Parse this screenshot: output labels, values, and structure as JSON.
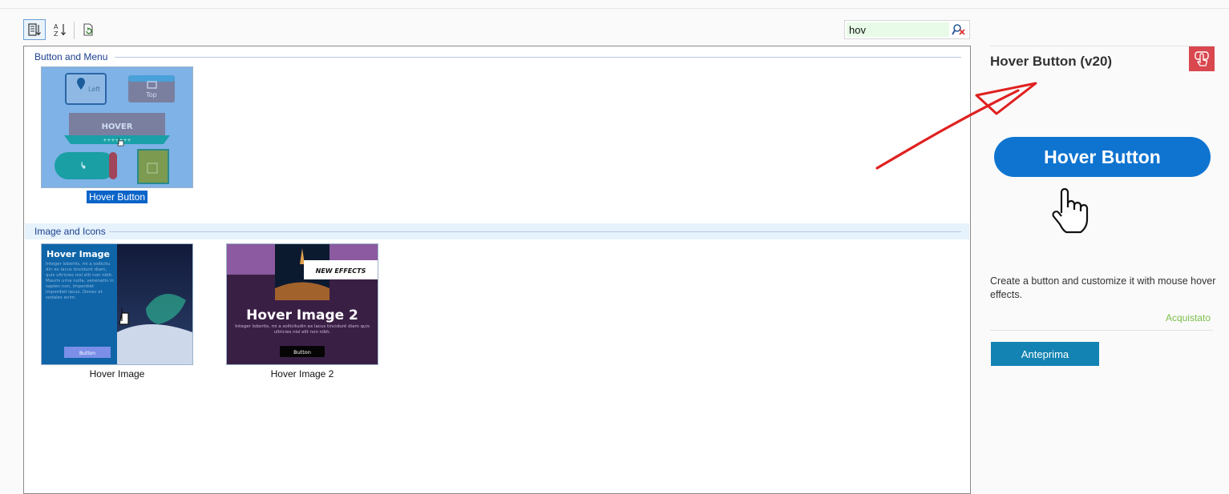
{
  "toolbar": {
    "categorized_icon": "categorized-view-icon",
    "alpha_icon": "sort-alphabetical-icon",
    "refresh_icon": "refresh-icon"
  },
  "search": {
    "value": "hov",
    "clear_icon": "clear-search-icon"
  },
  "categories": [
    {
      "title": "Button and Menu",
      "items": [
        {
          "label": "Hover Button"
        }
      ]
    },
    {
      "title": "Image and Icons",
      "items": [
        {
          "label": "Hover Image"
        },
        {
          "label": "Hover Image 2"
        }
      ]
    }
  ],
  "thumbs": {
    "hover_button": {
      "left": "Left",
      "top": "Top",
      "hover": "HOVER",
      "sub": "+++++++"
    },
    "hover_image": {
      "title": "Hover Image",
      "body": "Integer lobortis, mi a sollicitu din ex lacus tincidunt diam, quis ultricies nisl elit non nibh. Mauris urna nulla, venenatis in sapien non, imperdiet imperdiet lacus. Donec et sodales enim.",
      "button": "Button"
    },
    "hover_image_2": {
      "badge": "NEW EFFECTS",
      "title": "Hover Image 2",
      "body": "Integer lobortis, mi a sollicitudin ex lacus tincidunt diam quis ultricies nisl elit non nibh.",
      "button": "Button"
    }
  },
  "detail": {
    "title": "Hover Button (v20)",
    "preview_text": "Hover Button",
    "description": "Create a button and customize it with mouse hover effects.",
    "status": "Acquistato",
    "preview_button": "Anteprima",
    "badge_icon": "tap-icon"
  },
  "colors": {
    "accent": "#0a64c8",
    "hero_button": "#0f74d0",
    "badge": "#d9474f",
    "status": "#7cc04a",
    "preview_button": "#1383b3",
    "annotation": "#e02020"
  }
}
